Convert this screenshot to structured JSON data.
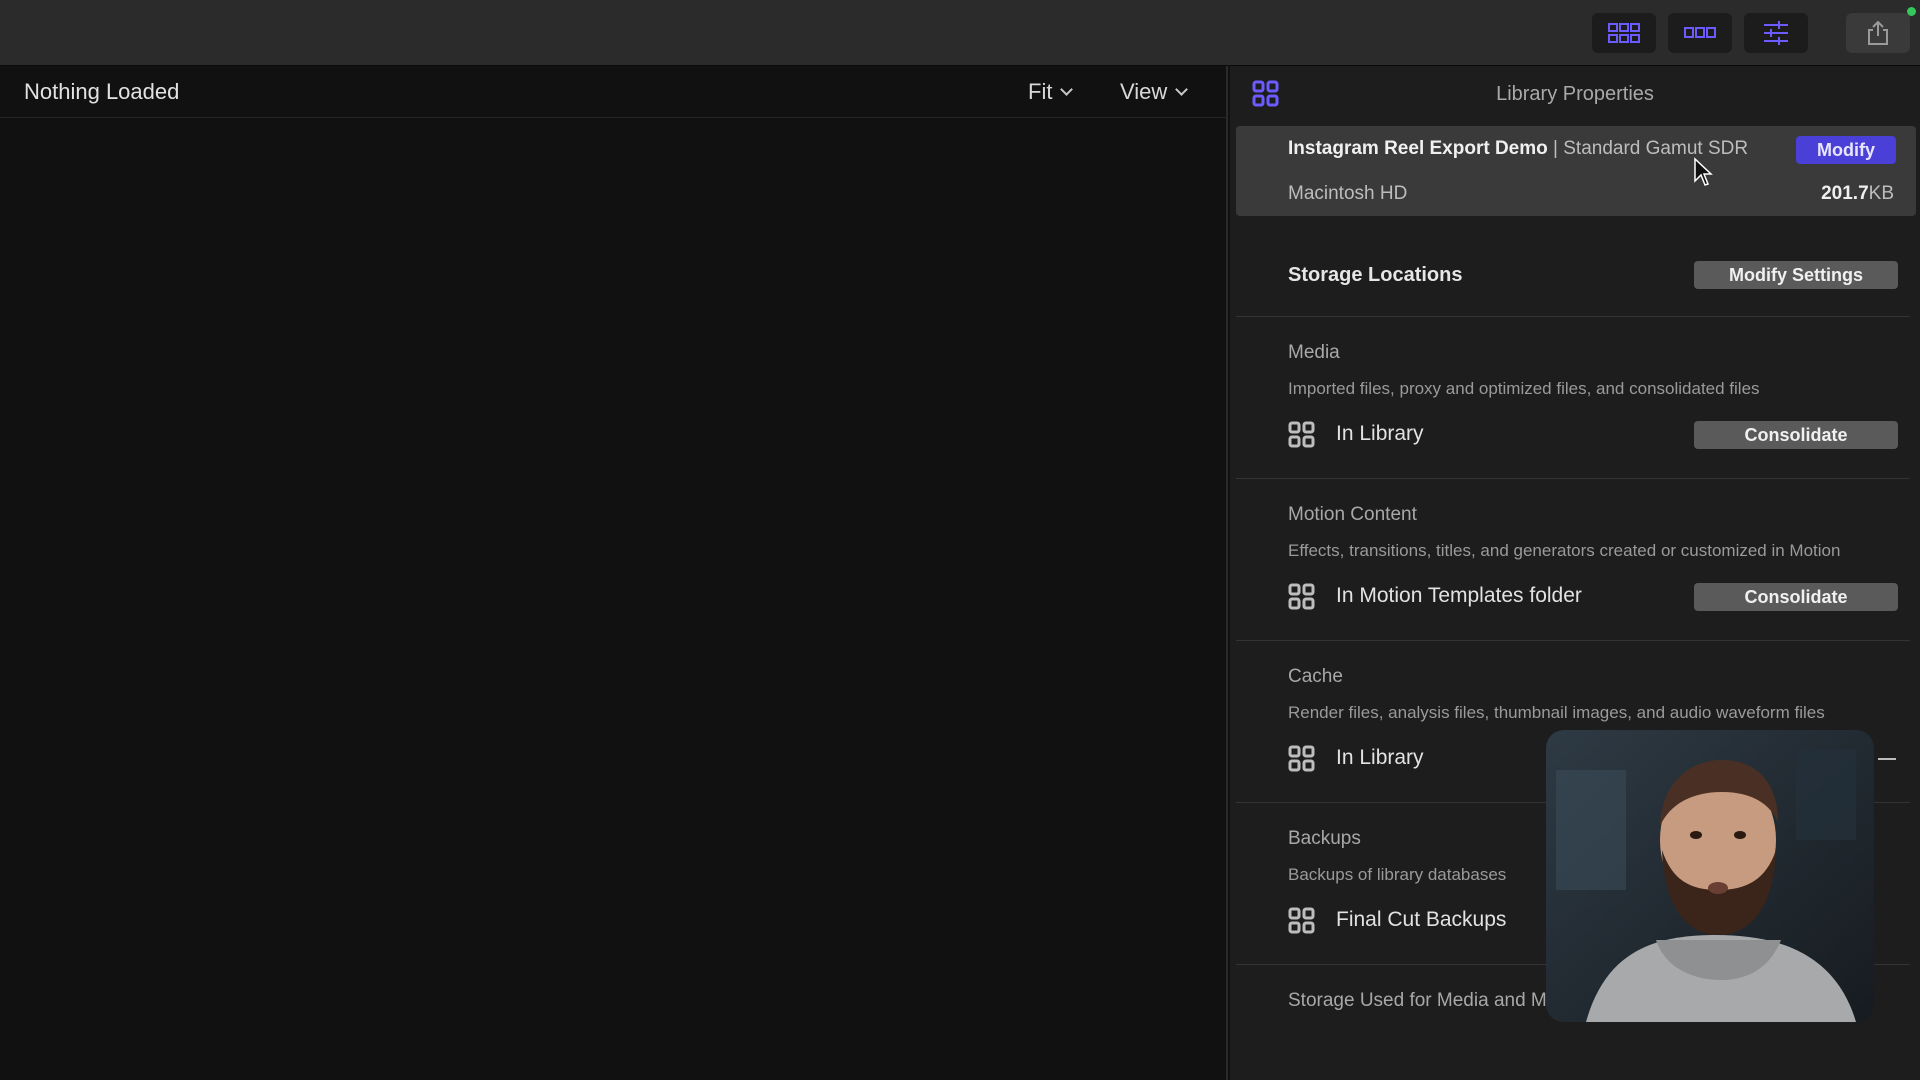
{
  "toolbar": {
    "buttons": [
      {
        "name": "browser-grid-button",
        "icon": "grid-icon"
      },
      {
        "name": "timeline-button",
        "icon": "timeline-icon"
      },
      {
        "name": "inspector-button",
        "icon": "sliders-icon"
      }
    ],
    "share_icon": "share-icon",
    "accent": "#5b4ee6"
  },
  "viewer": {
    "title": "Nothing Loaded",
    "fit_label": "Fit",
    "view_label": "View"
  },
  "inspector": {
    "title": "Library Properties",
    "library": {
      "name": "Instagram Reel Export Demo",
      "separator": "|",
      "gamut": "Standard Gamut SDR",
      "modify_label": "Modify",
      "disk": "Macintosh HD",
      "size_value": "201.7",
      "size_unit": "KB"
    },
    "storage": {
      "title": "Storage Locations",
      "modify_settings_label": "Modify Settings"
    },
    "sections": [
      {
        "title": "Media",
        "description": "Imported files, proxy and optimized files, and consolidated files",
        "location": "In Library",
        "button": "Consolidate"
      },
      {
        "title": "Motion Content",
        "description": "Effects, transitions, titles, and generators created or customized in Motion",
        "location": "In Motion Templates folder",
        "button": "Consolidate"
      },
      {
        "title": "Cache",
        "description": "Render files, analysis files, thumbnail images, and audio waveform files",
        "location": "In Library"
      },
      {
        "title": "Backups",
        "description": "Backups of library databases",
        "location": "Final Cut Backups"
      }
    ],
    "footer_partial": "Storage Used for Media and M"
  }
}
